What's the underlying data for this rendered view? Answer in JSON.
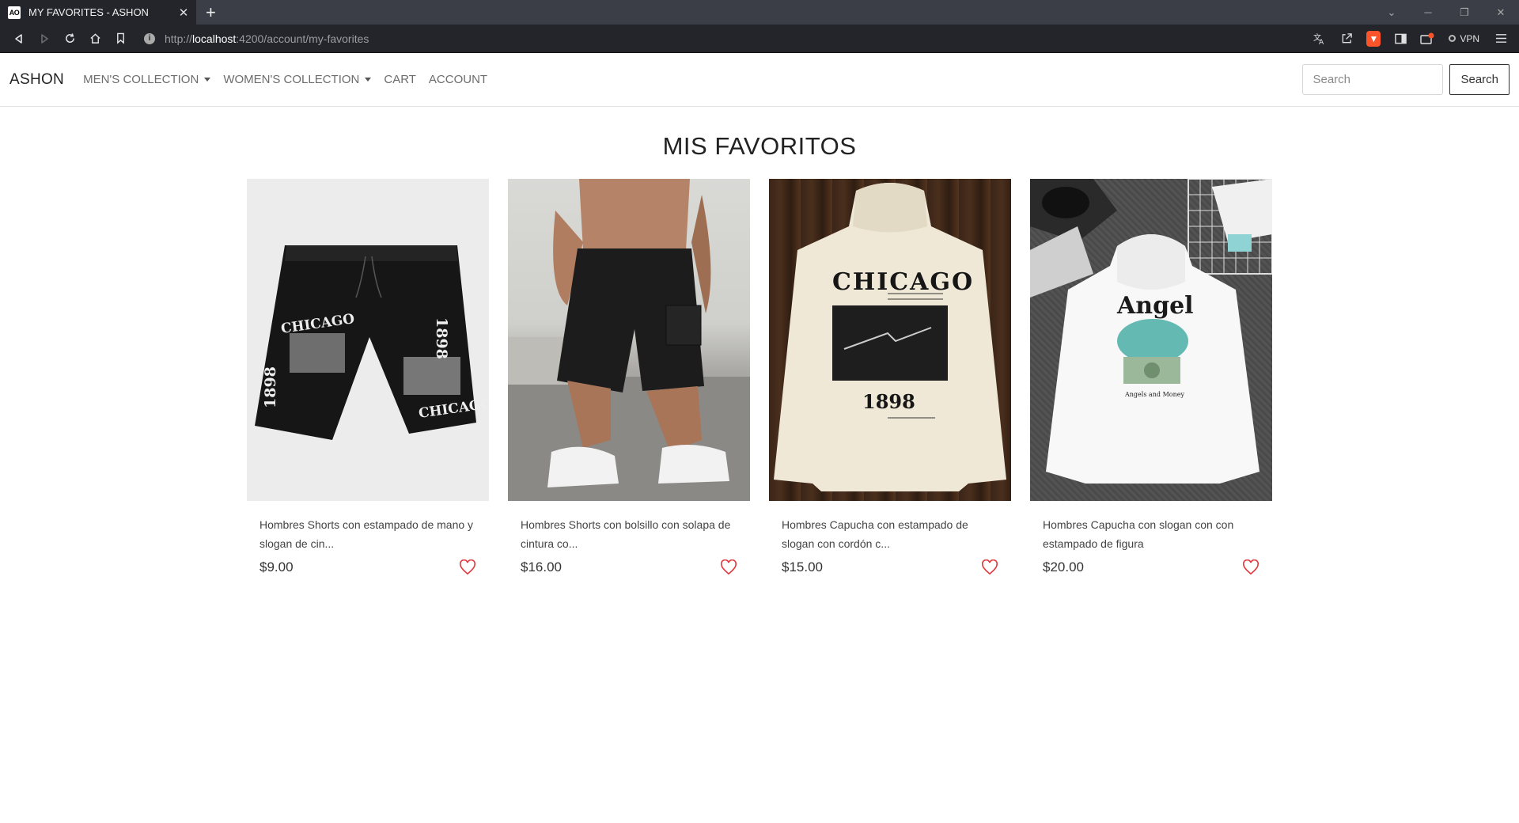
{
  "browser": {
    "tab_title": "MY FAVORITES - ASHON",
    "favicon_text": "AO",
    "url_scheme": "http://",
    "url_host": "localhost",
    "url_path": ":4200/account/my-favorites",
    "vpn_label": "VPN"
  },
  "nav": {
    "brand": "ASHON",
    "links": [
      "MEN'S COLLECTION",
      "WOMEN'S COLLECTION",
      "CART",
      "ACCOUNT"
    ],
    "search_placeholder": "Search",
    "search_button": "Search"
  },
  "page": {
    "title": "MIS FAVORITOS"
  },
  "products": [
    {
      "name": "Hombres Shorts con estampado de mano y slogan de cin...",
      "price": "$9.00",
      "print_text": "CHICAGO",
      "print_year": "1898"
    },
    {
      "name": "Hombres Shorts con bolsillo con solapa de cintura co...",
      "price": "$16.00"
    },
    {
      "name": "Hombres Capucha con estampado de slogan con cordón c...",
      "price": "$15.00",
      "print_text": "CHICAGO",
      "print_year": "1898"
    },
    {
      "name": "Hombres Capucha con slogan con con estampado de figura",
      "price": "$20.00",
      "print_text": "Angel",
      "print_sub": "Angels and Money"
    }
  ],
  "colors": {
    "heart": "#e0393e",
    "brave": "#fb542b"
  }
}
